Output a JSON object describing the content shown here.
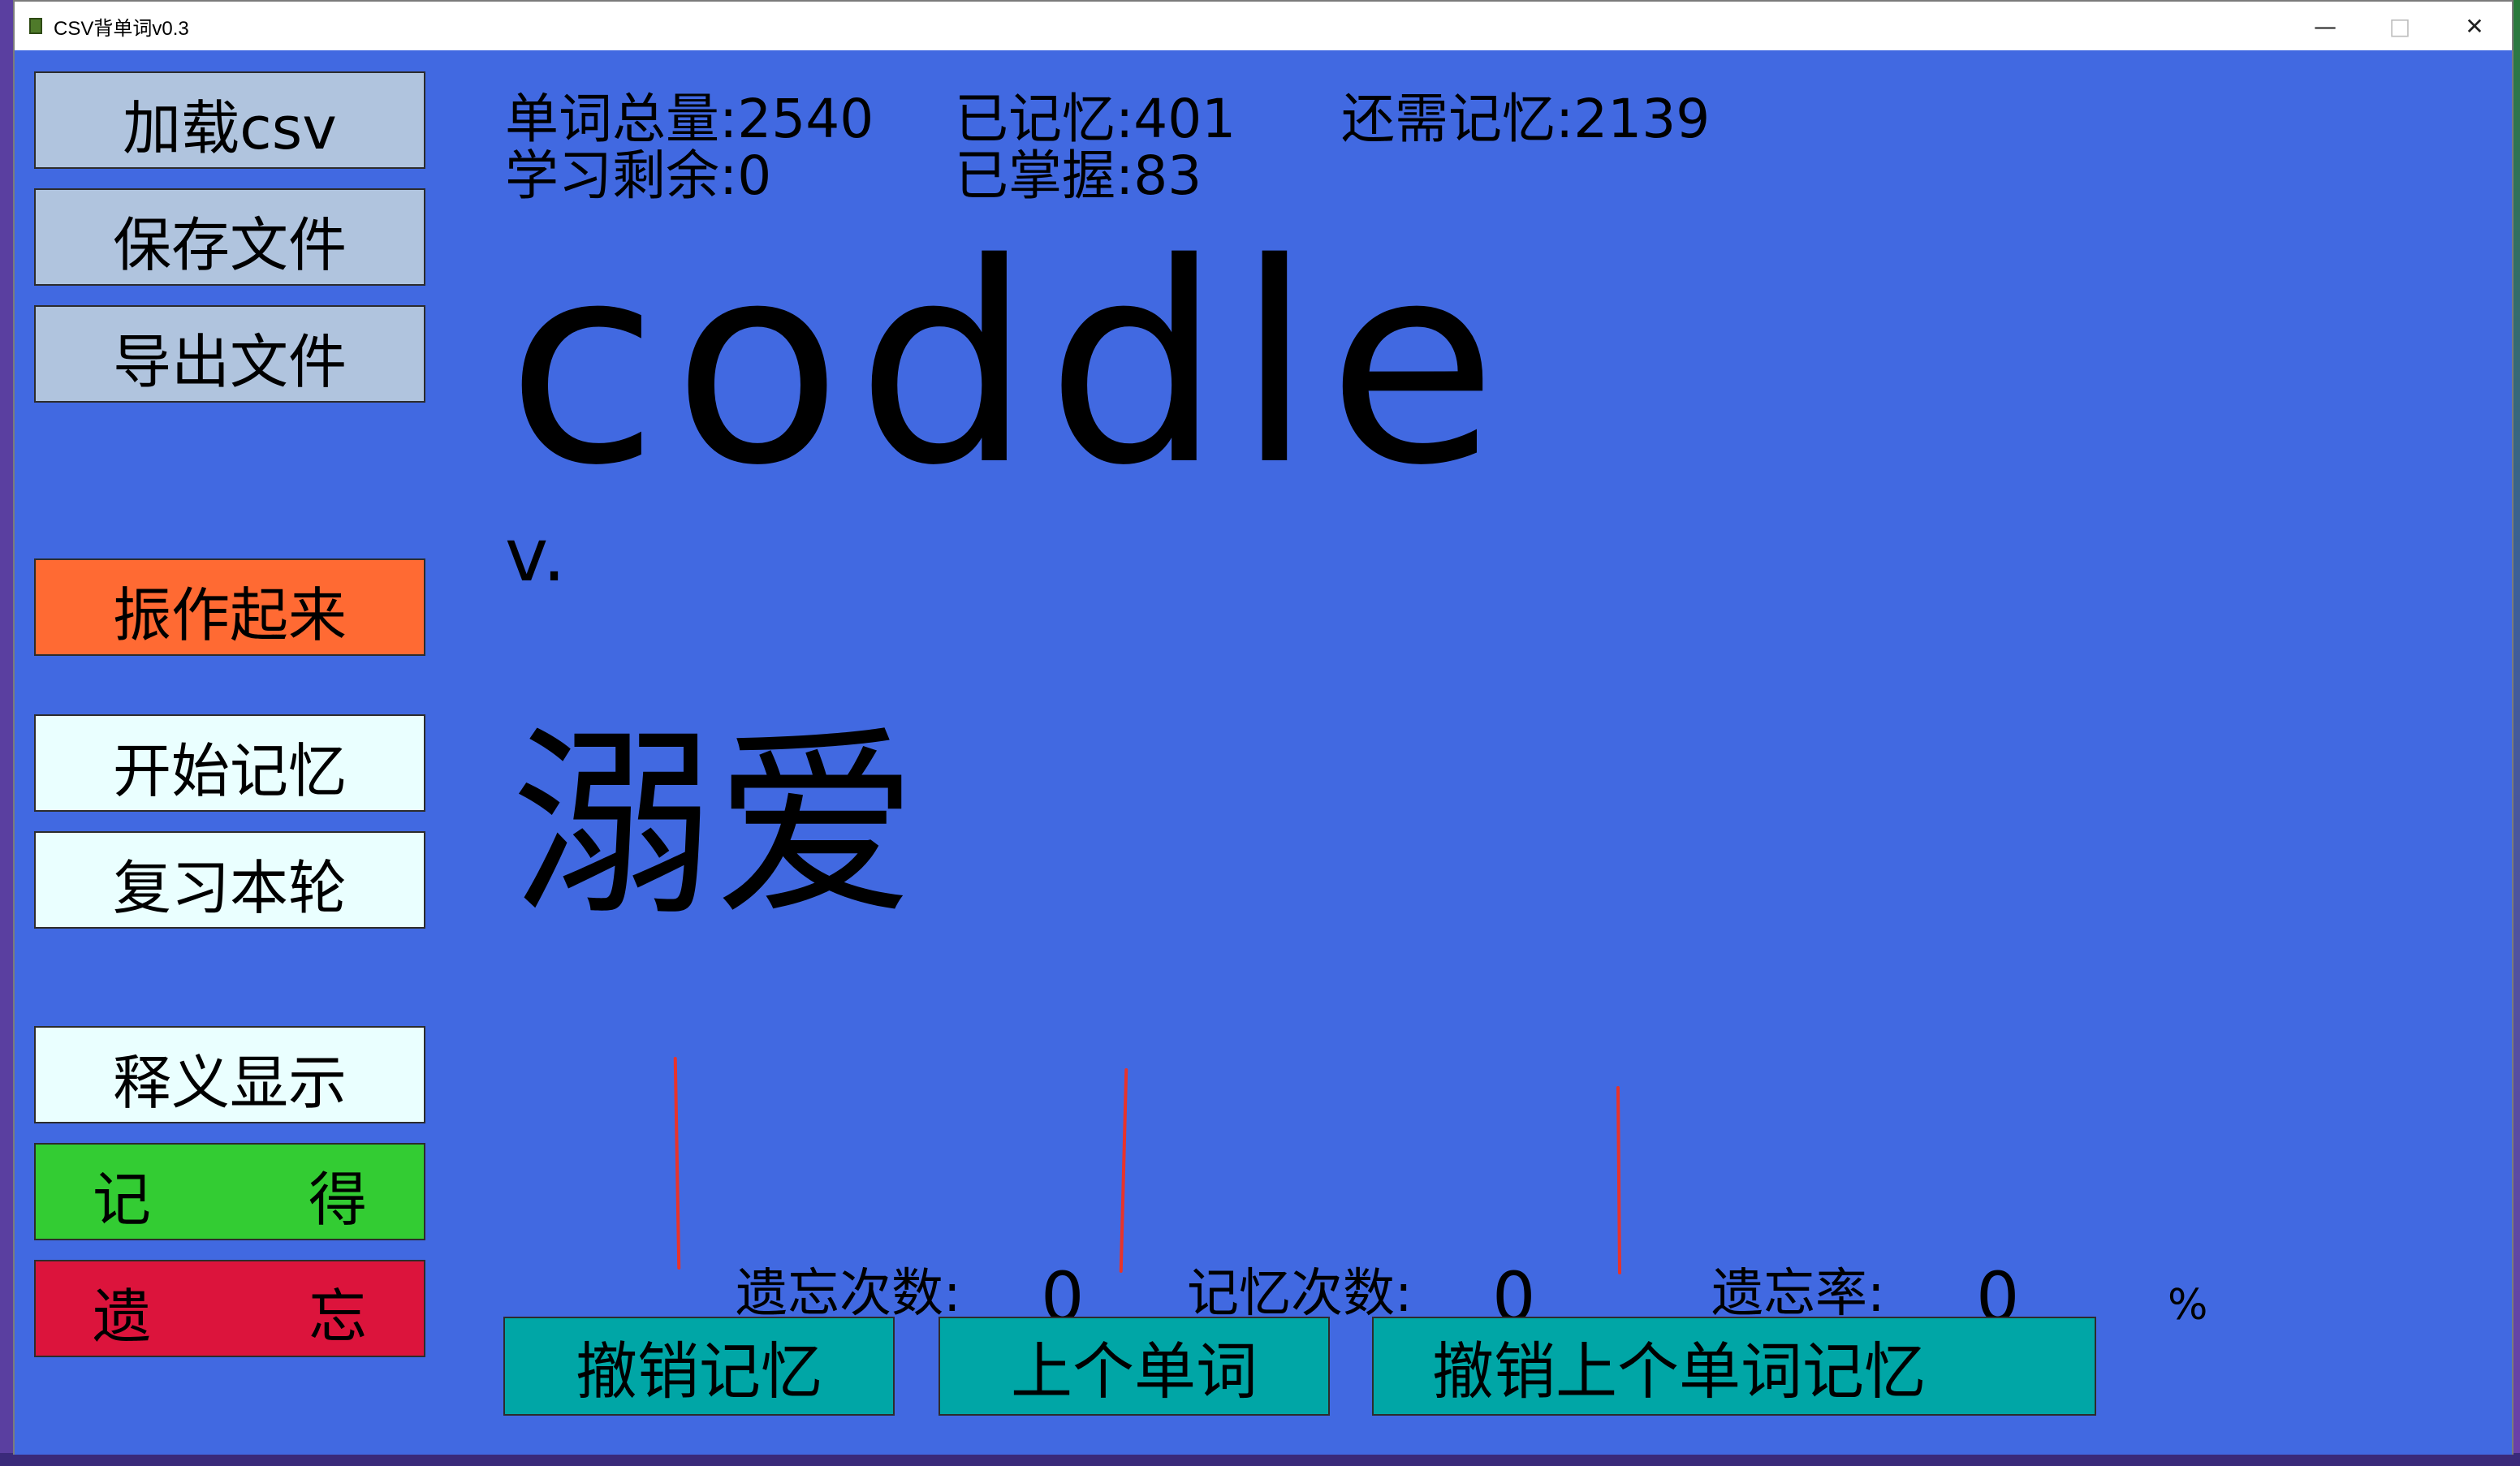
{
  "window": {
    "title": "CSV背单词v0.3"
  },
  "sidebar": {
    "load_csv": "加载csv",
    "save_file": "保存文件",
    "export_file": "导出文件",
    "cheer_up": "振作起来",
    "start_memory": "开始记忆",
    "review_round": "复习本轮",
    "show_meaning": "释义显示",
    "remember_left": "记",
    "remember_right": "得",
    "forget_left": "遗",
    "forget_right": "忘"
  },
  "stats": {
    "total": "单词总量:2540",
    "memorized": "已记忆:401",
    "remaining_to_memorize": "还需记忆:2139",
    "study_remaining": "学习剩余:0",
    "mastered": "已掌握:83"
  },
  "card": {
    "word": "coddle",
    "part_of_speech": "v.",
    "meaning": "溺爱"
  },
  "counters": {
    "forget_count_label": "遗忘次数:",
    "forget_count_value": "0",
    "memory_count_label": "记忆次数:",
    "memory_count_value": "0",
    "forget_rate_label": "遗忘率:",
    "forget_rate_value": "0",
    "percent_sign": "%"
  },
  "actions": {
    "undo_memory": "撤销记忆",
    "previous_word": "上个单词",
    "undo_previous_memory": "撤销上个单词记忆"
  },
  "colors": {
    "client_bg": "#4169e1",
    "button_gray": "#b0c4de",
    "button_orange": "#ff6a33",
    "button_white": "#eaffff",
    "button_green": "#33cc33",
    "button_red": "#dc143c",
    "button_teal": "#00a6a6"
  },
  "icons": [
    "app-icon",
    "minimize-icon",
    "maximize-icon",
    "close-icon"
  ]
}
